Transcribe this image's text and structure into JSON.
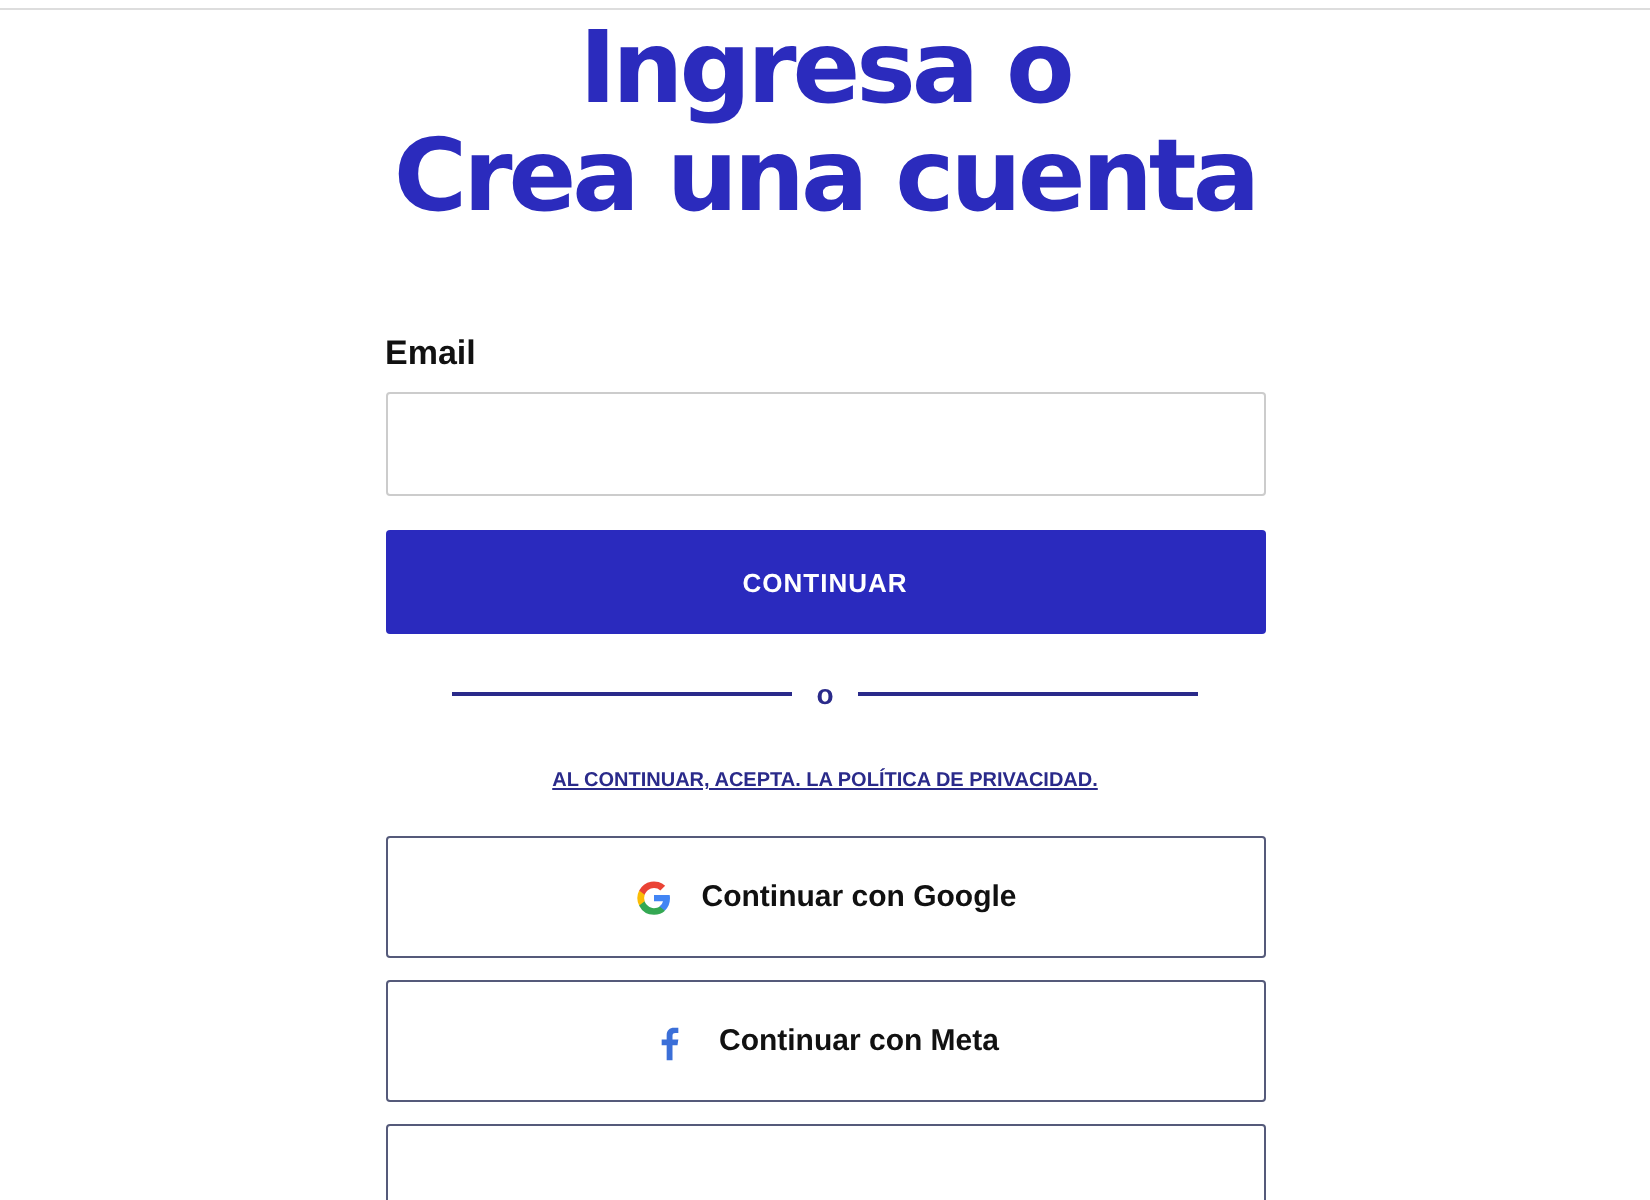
{
  "title_lines": [
    "Ingresa o",
    "Crea una cuenta"
  ],
  "email": {
    "label": "Email"
  },
  "continue_button": "CONTINUAR",
  "divider": "o",
  "privacy_link": "AL CONTINUAR, ACEPTA. LA POLÍTICA DE PRIVACIDAD.",
  "social_buttons": [
    {
      "kind": "google",
      "label": "Continuar con Google"
    },
    {
      "kind": "meta",
      "label": "Continuar con Meta"
    },
    {
      "kind": "other"
    }
  ]
}
